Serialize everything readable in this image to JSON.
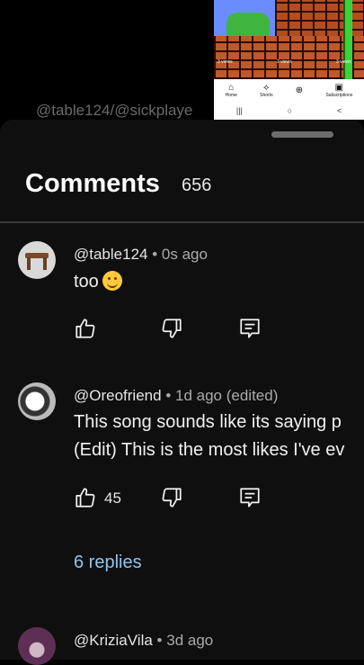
{
  "background": {
    "caption": "@table124/@sickplaye",
    "preview": {
      "views": [
        "3 views",
        "2 views",
        "3 views"
      ],
      "nav": [
        "Home",
        "Shorts",
        "",
        "Subscriptions"
      ],
      "sys": [
        "|||",
        "○",
        "<"
      ]
    }
  },
  "comments": {
    "title": "Comments",
    "count": "656",
    "items": [
      {
        "author": "@table124",
        "sep": "•",
        "time": "0s ago",
        "text": "too",
        "likes": ""
      },
      {
        "author": "@Oreofriend",
        "sep": "•",
        "time": "1d ago (edited)",
        "line1": "This song sounds like its saying p",
        "line2": "(Edit) This is the most likes I've ev",
        "likes": "45",
        "replies": "6 replies"
      },
      {
        "author": "@KriziaVila",
        "sep": "•",
        "time": "3d ago"
      }
    ]
  },
  "colors": {
    "sheet": "#0f0f0f",
    "link": "#8ec5f1"
  }
}
